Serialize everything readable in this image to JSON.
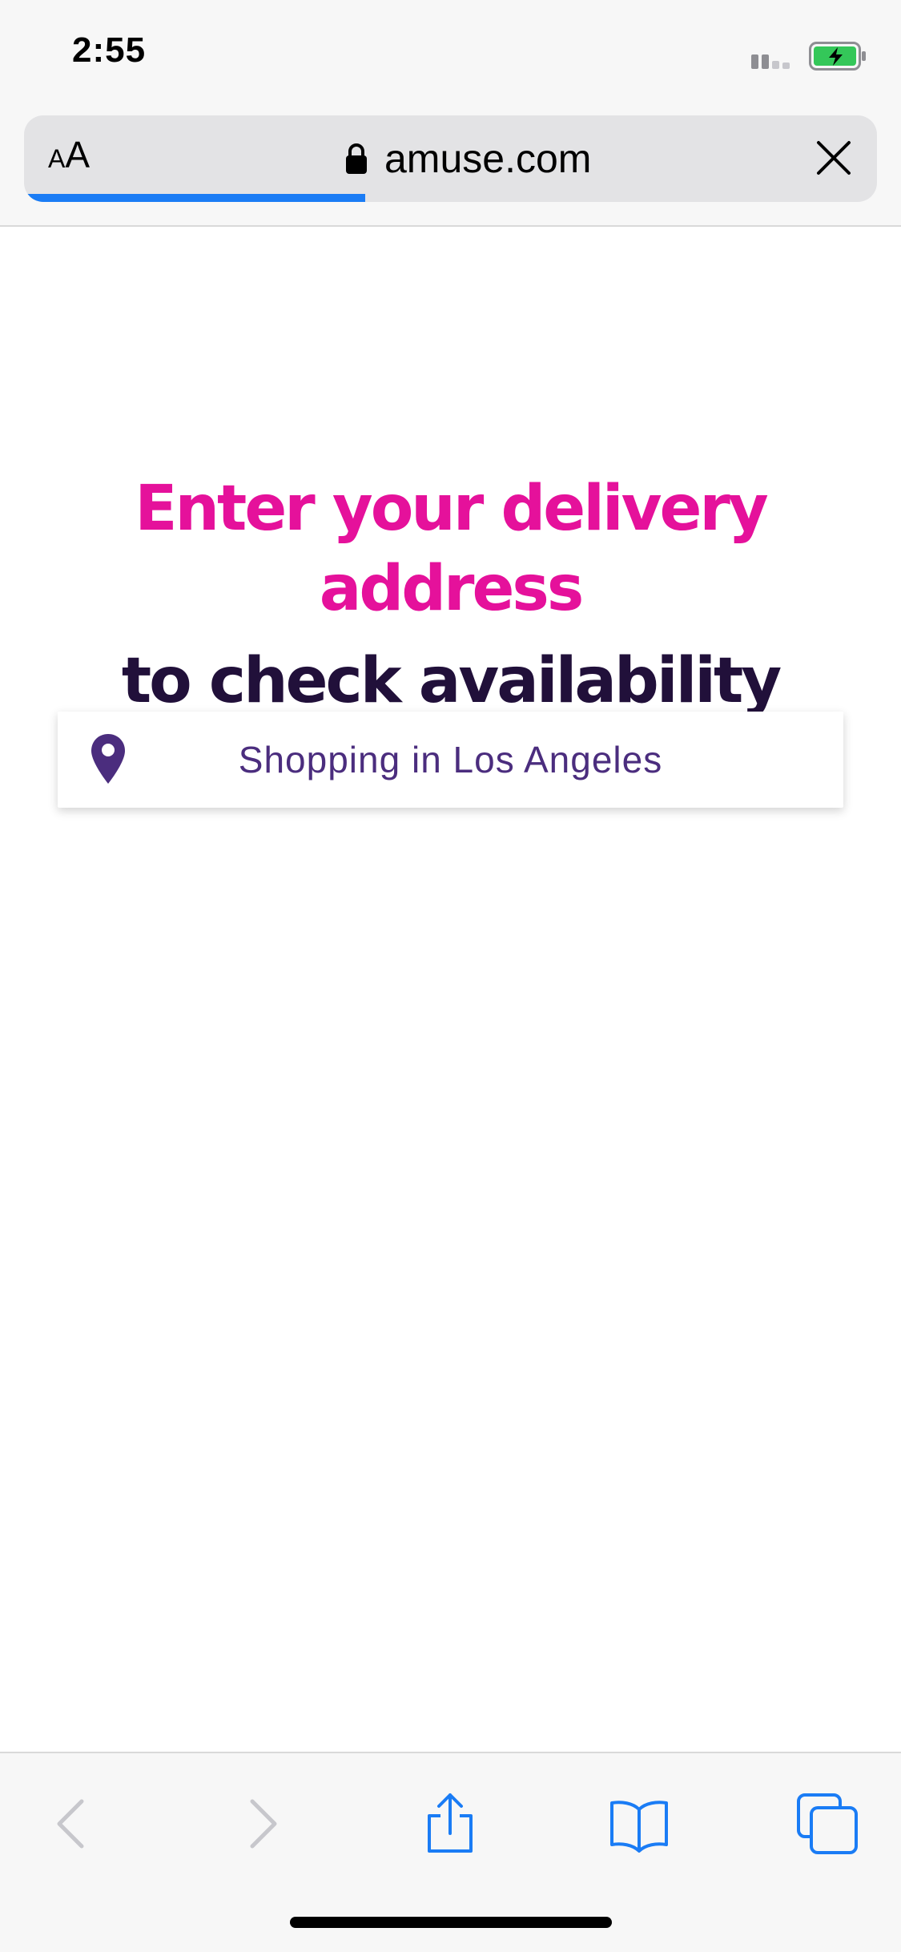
{
  "status_bar": {
    "time": "2:55",
    "signal_icon": "signal-bars-icon",
    "battery_icon": "battery-charging-icon",
    "battery_color": "#34c759"
  },
  "address_bar": {
    "text_size_small": "A",
    "text_size_big": "A",
    "url": "amuse.com",
    "lock_icon": "lock-icon",
    "close_icon": "close-icon",
    "load_progress": 0.4,
    "progress_color": "#1a7cf5"
  },
  "main": {
    "headline_line1": "Enter your delivery address",
    "headline_line2": "to check availability",
    "headline_color1": "#e5119b",
    "headline_color2": "#21103a",
    "location_label": "Shopping in Los Angeles",
    "location_icon": "map-pin-icon",
    "location_color": "#4b2d7e"
  },
  "toolbar": {
    "back_icon": "chevron-left-icon",
    "forward_icon": "chevron-right-icon",
    "share_icon": "share-icon",
    "bookmarks_icon": "book-icon",
    "tabs_icon": "tabs-icon",
    "accent_color": "#1a7cf5"
  }
}
